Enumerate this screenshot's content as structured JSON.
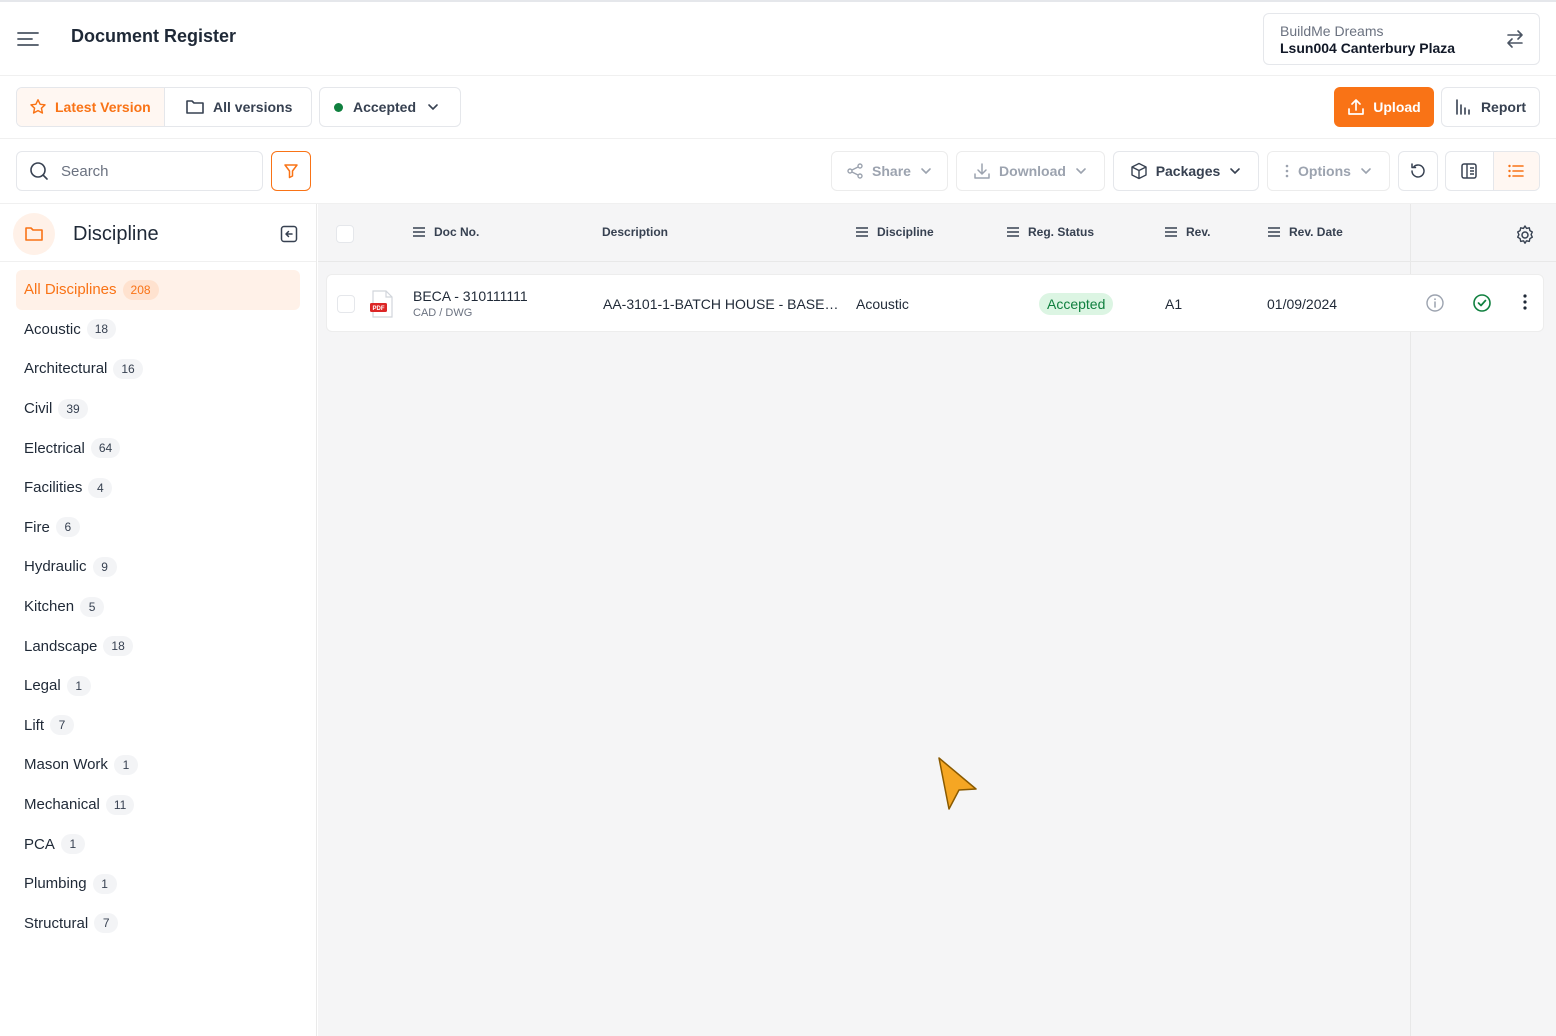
{
  "header": {
    "title": "Document Register",
    "project_org": "BuildMe Dreams",
    "project_name": "Lsun004 Canterbury Plaza"
  },
  "toolbar": {
    "latest_version": "Latest Version",
    "all_versions": "All versions",
    "status_filter": "Accepted",
    "upload": "Upload",
    "report": "Report"
  },
  "actions": {
    "search_placeholder": "Search",
    "share": "Share",
    "download": "Download",
    "packages": "Packages",
    "options": "Options"
  },
  "sidebar": {
    "title": "Discipline",
    "items": [
      {
        "label": "All Disciplines",
        "count": "208"
      },
      {
        "label": "Acoustic",
        "count": "18"
      },
      {
        "label": "Architectural",
        "count": "16"
      },
      {
        "label": "Civil",
        "count": "39"
      },
      {
        "label": "Electrical",
        "count": "64"
      },
      {
        "label": "Facilities",
        "count": "4"
      },
      {
        "label": "Fire",
        "count": "6"
      },
      {
        "label": "Hydraulic",
        "count": "9"
      },
      {
        "label": "Kitchen",
        "count": "5"
      },
      {
        "label": "Landscape",
        "count": "18"
      },
      {
        "label": "Legal",
        "count": "1"
      },
      {
        "label": "Lift",
        "count": "7"
      },
      {
        "label": "Mason Work",
        "count": "1"
      },
      {
        "label": "Mechanical",
        "count": "11"
      },
      {
        "label": "PCA",
        "count": "1"
      },
      {
        "label": "Plumbing",
        "count": "1"
      },
      {
        "label": "Structural",
        "count": "7"
      }
    ]
  },
  "table": {
    "columns": {
      "doc_no": "Doc No.",
      "description": "Description",
      "discipline": "Discipline",
      "reg_status": "Reg. Status",
      "rev": "Rev.",
      "rev_date": "Rev. Date"
    },
    "rows": [
      {
        "doc_no": "BECA - 310111111",
        "doc_type": "CAD / DWG",
        "file_badge": "PDF",
        "description": "AA-3101-1-BATCH HOUSE - BASE…",
        "discipline": "Acoustic",
        "reg_status": "Accepted",
        "rev": "A1",
        "rev_date": "01/09/2024"
      }
    ]
  },
  "colors": {
    "accent": "#f97316",
    "status_green": "#10803f"
  }
}
